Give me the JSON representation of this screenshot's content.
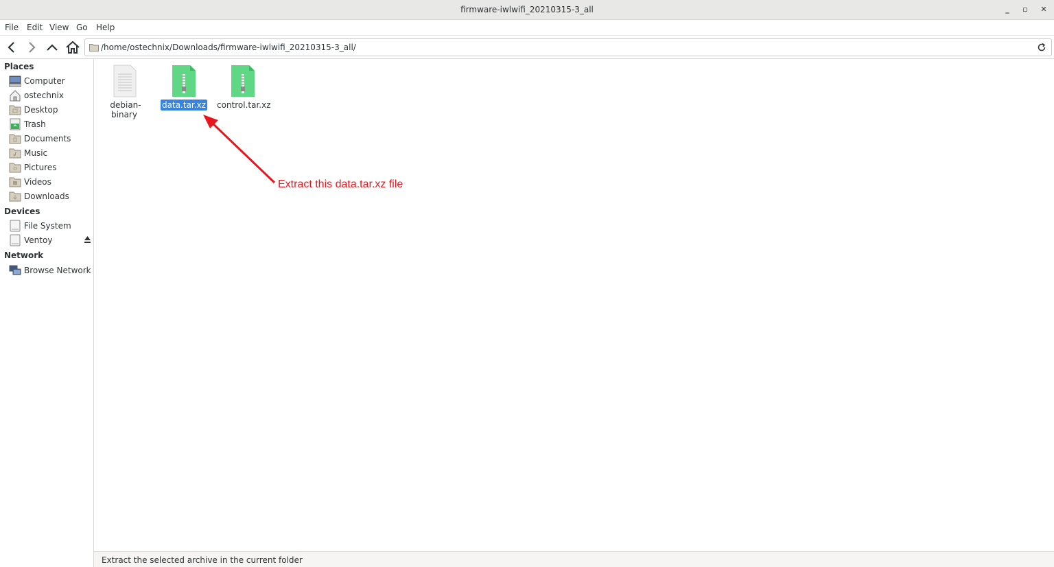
{
  "window": {
    "title": "firmware-iwlwifi_20210315-3_all",
    "minimize": "_",
    "maximize": "▫",
    "close": "✕"
  },
  "menubar": {
    "items": [
      "File",
      "Edit",
      "View",
      "Go",
      "Help"
    ]
  },
  "toolbar": {
    "location": "/home/ostechnix/Downloads/firmware-iwlwifi_20210315-3_all/"
  },
  "sidebar": {
    "places_header": "Places",
    "places": [
      {
        "label": "Computer",
        "icon": "computer-icon"
      },
      {
        "label": "ostechnix",
        "icon": "home-icon"
      },
      {
        "label": "Desktop",
        "icon": "desktop-folder-icon"
      },
      {
        "label": "Trash",
        "icon": "trash-icon"
      },
      {
        "label": "Documents",
        "icon": "documents-folder-icon"
      },
      {
        "label": "Music",
        "icon": "music-folder-icon"
      },
      {
        "label": "Pictures",
        "icon": "pictures-folder-icon"
      },
      {
        "label": "Videos",
        "icon": "videos-folder-icon"
      },
      {
        "label": "Downloads",
        "icon": "downloads-folder-icon"
      }
    ],
    "devices_header": "Devices",
    "devices": [
      {
        "label": "File System",
        "icon": "drive-icon"
      },
      {
        "label": "Ventoy",
        "icon": "drive-icon"
      }
    ],
    "network_header": "Network",
    "network": [
      {
        "label": "Browse Network",
        "icon": "network-icon"
      }
    ]
  },
  "files": [
    {
      "name": "debian-binary",
      "icon": "text-file-icon",
      "selected": false
    },
    {
      "name": "data.tar.xz",
      "icon": "archive-icon",
      "selected": true
    },
    {
      "name": "control.tar.xz",
      "icon": "archive-icon",
      "selected": false
    }
  ],
  "annotation": {
    "text": "Extract this data.tar.xz file",
    "color": "#e8161c"
  },
  "statusbar": {
    "text": "Extract the selected archive in the current folder"
  },
  "colors": {
    "selection": "#3584e4",
    "archive": "#5fd785"
  }
}
